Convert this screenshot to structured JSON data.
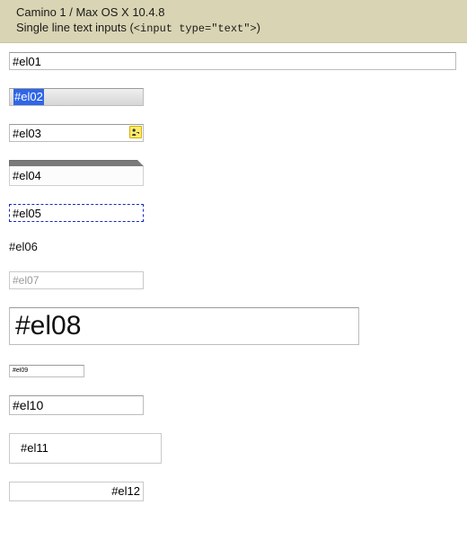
{
  "header": {
    "line1": "Camino 1 / Max OS X 10.4.8",
    "subtitle_prefix": "Single line text inputs (",
    "subtitle_code": "<input type=\"text\">",
    "subtitle_suffix": ")"
  },
  "inputs": {
    "el01": "#el01",
    "el02": "#el02",
    "el03": "#el03",
    "el04": "#el04",
    "el05": "#el05",
    "el06": "#el06",
    "el07": "#el07",
    "el08": "#el08",
    "el09": "#el09",
    "el10": "#el10",
    "el11": "#el11",
    "el12": "#el12"
  },
  "icons": {
    "el03_badge": "person-key-icon"
  }
}
